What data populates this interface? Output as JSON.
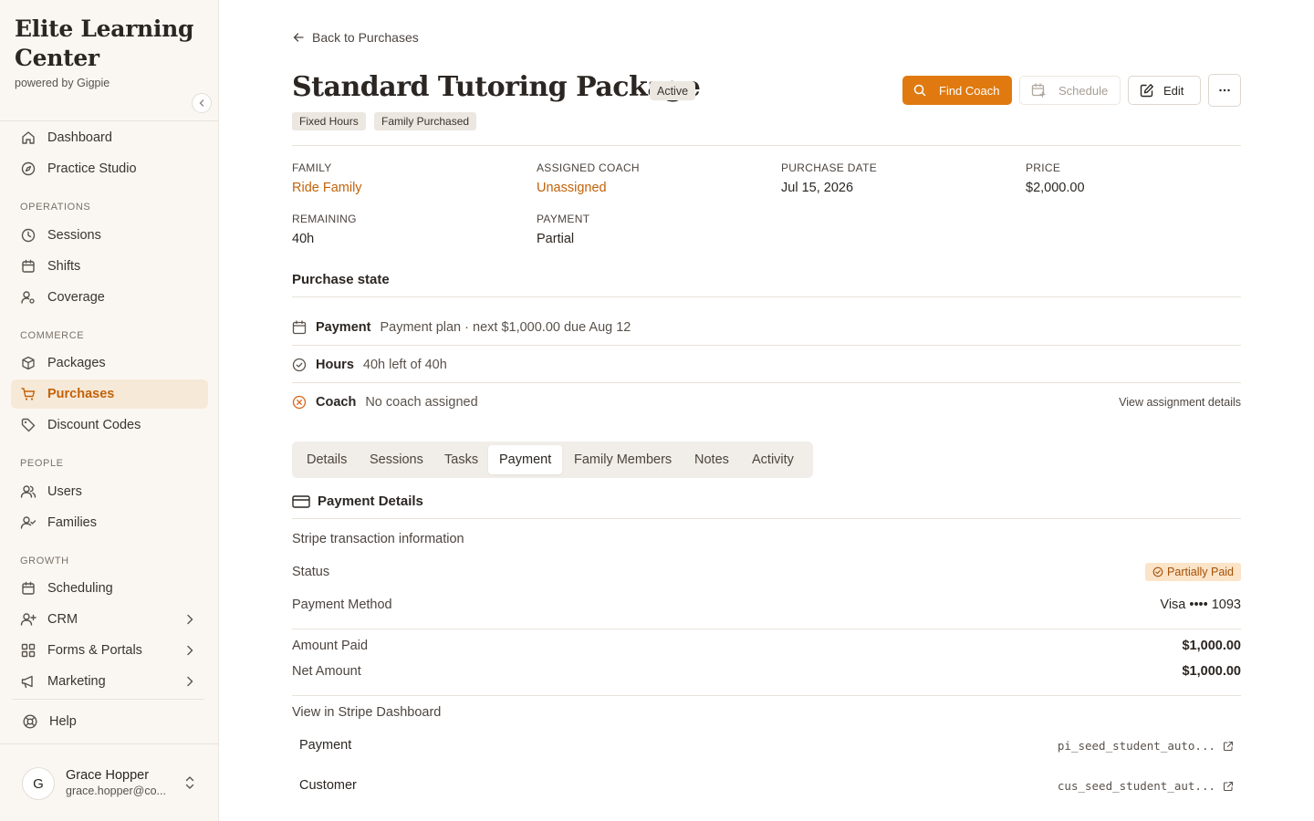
{
  "brand": {
    "title_line1": "Elite Learning",
    "title_line2": "Center",
    "subtitle": "powered by Gigpie"
  },
  "sidebar": {
    "top_items": [
      {
        "label": "Dashboard",
        "icon": "home-icon"
      },
      {
        "label": "Practice Studio",
        "icon": "compass-icon"
      }
    ],
    "sections": [
      {
        "title": "OPERATIONS",
        "items": [
          {
            "label": "Sessions",
            "icon": "clock-icon"
          },
          {
            "label": "Shifts",
            "icon": "calendar-icon"
          },
          {
            "label": "Coverage",
            "icon": "user-cog-icon"
          }
        ]
      },
      {
        "title": "COMMERCE",
        "items": [
          {
            "label": "Packages",
            "icon": "package-icon"
          },
          {
            "label": "Purchases",
            "icon": "cart-icon",
            "active": true
          },
          {
            "label": "Discount Codes",
            "icon": "tag-icon"
          }
        ]
      },
      {
        "title": "PEOPLE",
        "items": [
          {
            "label": "Users",
            "icon": "users-icon"
          },
          {
            "label": "Families",
            "icon": "user-check-icon"
          }
        ]
      },
      {
        "title": "GROWTH",
        "items": [
          {
            "label": "Scheduling",
            "icon": "calendar-icon"
          },
          {
            "label": "CRM",
            "icon": "user-plus-icon"
          },
          {
            "label": "Forms & Portals",
            "icon": "grid-icon"
          },
          {
            "label": "Marketing",
            "icon": "megaphone-icon"
          }
        ]
      }
    ],
    "help": "Help"
  },
  "user": {
    "initial": "G",
    "name": "Grace Hopper",
    "email": "grace.hopper@co..."
  },
  "header": {
    "back": "Back to Purchases",
    "title": "Standard Tutoring Package",
    "status": "Active",
    "tags": [
      "Fixed Hours",
      "Family Purchased"
    ],
    "find_coach": "Find Coach",
    "schedule": "Schedule",
    "edit": "Edit"
  },
  "info": {
    "family": {
      "label": "FAMILY",
      "value": "Ride Family"
    },
    "coach": {
      "label": "ASSIGNED COACH",
      "value": "Unassigned"
    },
    "purchase_date": {
      "label": "PURCHASE DATE",
      "value": "Jul 15, 2026"
    },
    "price": {
      "label": "PRICE",
      "value": "$2,000.00"
    },
    "remaining": {
      "label": "REMAINING",
      "value": "40h"
    },
    "payment": {
      "label": "PAYMENT",
      "value": "Partial"
    }
  },
  "purchase_state": {
    "title": "Purchase state",
    "rows": [
      {
        "label": "Payment",
        "value": "Payment plan · next $1,000.00 due Aug 12"
      },
      {
        "label": "Hours",
        "value": "40h left of 40h"
      },
      {
        "label": "Coach",
        "value": "No coach assigned",
        "action": "View assignment details"
      }
    ]
  },
  "tabs": [
    "Details",
    "Sessions",
    "Tasks",
    "Payment",
    "Family Members",
    "Notes",
    "Activity"
  ],
  "payment_details": {
    "title": "Payment Details",
    "subtitle": "Stripe transaction information",
    "status_label": "Status",
    "status_value": "Partially Paid",
    "method_label": "Payment Method",
    "method_value": "Visa •••• 1093",
    "amount_paid_label": "Amount Paid",
    "amount_paid_value": "$1,000.00",
    "net_amount_label": "Net Amount",
    "net_amount_value": "$1,000.00",
    "stripe_link": "View in Stripe Dashboard",
    "refs": [
      {
        "label": "Payment",
        "value": "pi_seed_student_auto..."
      },
      {
        "label": "Customer",
        "value": "cus_seed_student_aut..."
      }
    ]
  },
  "colors": {
    "accent": "#e07a10",
    "accent_text": "#c2620a",
    "sidebar_bg": "#faf7f3",
    "active_bg": "#f7e9d8",
    "warning": "#d9641a",
    "badge_bg": "#fbe4c8"
  }
}
